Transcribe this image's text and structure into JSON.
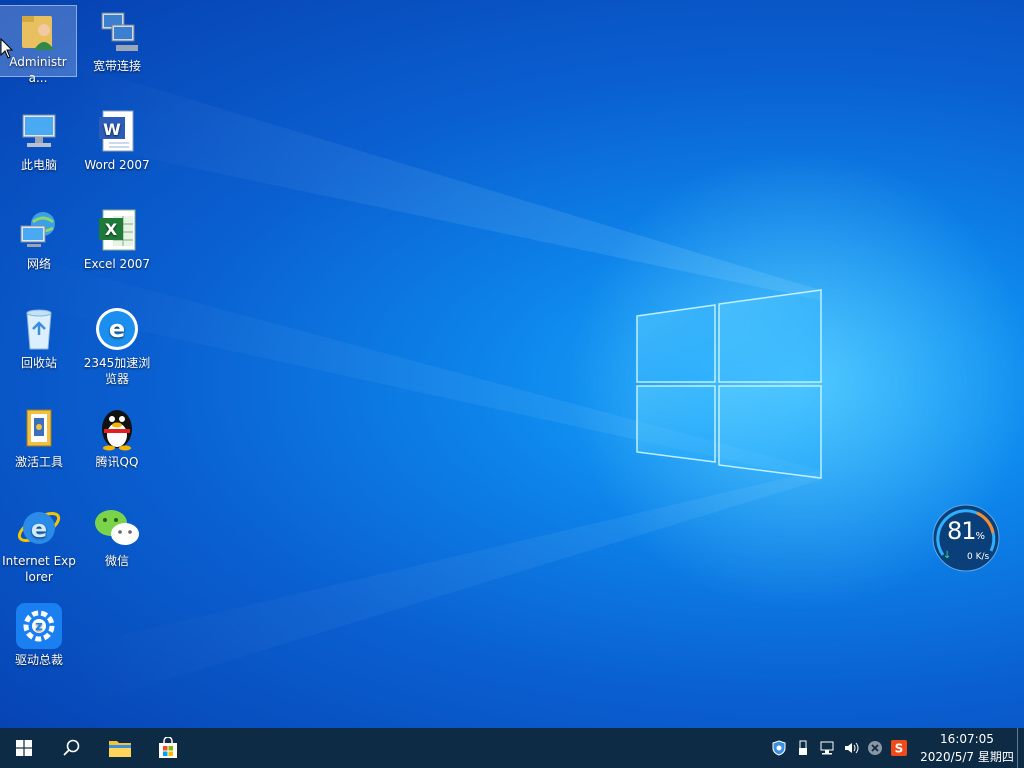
{
  "desktop": {
    "icons": [
      {
        "id": "administrator",
        "label": "Administra..."
      },
      {
        "id": "broadband",
        "label": "宽带连接"
      },
      {
        "id": "this-pc",
        "label": "此电脑"
      },
      {
        "id": "word",
        "label": "Word 2007"
      },
      {
        "id": "network",
        "label": "网络"
      },
      {
        "id": "excel",
        "label": "Excel 2007"
      },
      {
        "id": "recycle-bin",
        "label": "回收站"
      },
      {
        "id": "browser-2345",
        "label": "2345加速浏览器"
      },
      {
        "id": "activation",
        "label": "激活工具"
      },
      {
        "id": "qq",
        "label": "腾讯QQ"
      },
      {
        "id": "ie",
        "label": "Internet Explorer"
      },
      {
        "id": "wechat",
        "label": "微信"
      },
      {
        "id": "driver",
        "label": "驱动总裁"
      }
    ]
  },
  "widget": {
    "percent": "81",
    "percent_unit": "%",
    "speed": "0 K/s"
  },
  "taskbar": {
    "buttons": [
      "start",
      "search",
      "file-explorer",
      "store"
    ],
    "tray_icons": [
      "security-shield-icon",
      "usb-icon",
      "network-icon",
      "volume-icon",
      "close-circle-icon",
      "sogou-input-icon"
    ],
    "clock": {
      "time": "16:07:05",
      "date": "2020/5/7 星期四"
    }
  },
  "colors": {
    "taskbar": "#0e2b46",
    "wallpaper_center": "#1aa9ff",
    "wallpaper_edge": "#0640b0"
  }
}
